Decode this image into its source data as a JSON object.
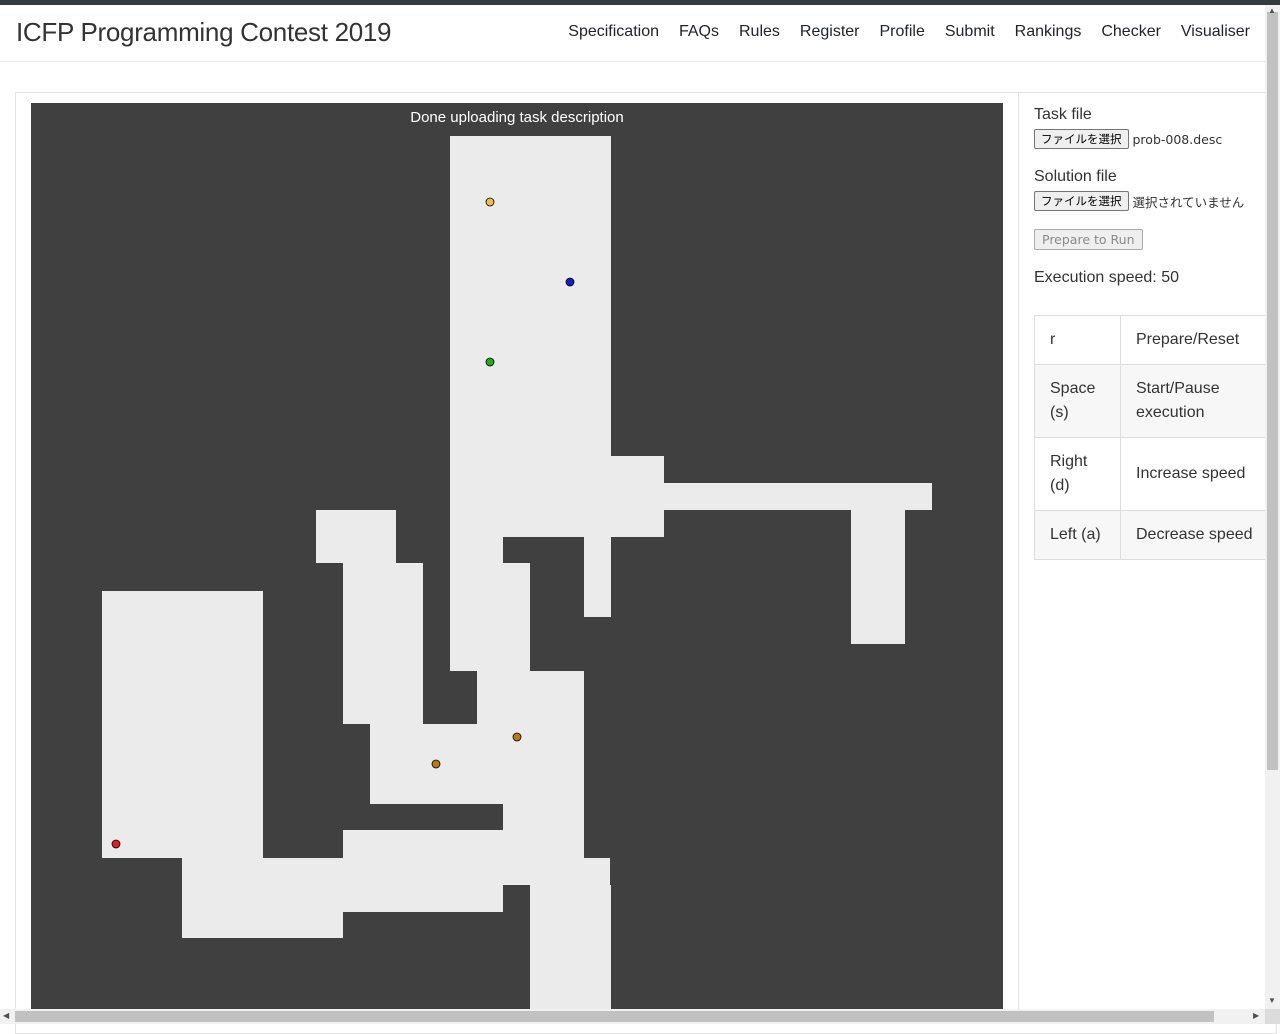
{
  "navbar": {
    "brand": "ICFP Programming Contest 2019",
    "links": [
      "Specification",
      "FAQs",
      "Rules",
      "Register",
      "Profile",
      "Submit",
      "Rankings",
      "Checker",
      "Visualiser"
    ]
  },
  "visualiser": {
    "status": "Done uploading task description",
    "colors": {
      "background": "#404040",
      "floor": "#ebebeb",
      "booster_yellow": "#f0c040",
      "booster_blue": "#1a1acc",
      "booster_green": "#22aa22",
      "booster_orange": "#b87a10",
      "worker_red": "#e02020"
    }
  },
  "panel": {
    "task_file_label": "Task file",
    "task_file_button": "ファイルを選択",
    "task_file_name": "prob-008.desc",
    "solution_file_label": "Solution file",
    "solution_file_button": "ファイルを選択",
    "solution_file_name": "選択されていません",
    "prepare_button": "Prepare to Run",
    "execution_speed": "Execution speed: 50"
  },
  "key_table": [
    {
      "key": "r",
      "action": "Prepare/Reset"
    },
    {
      "key": "Space (s)",
      "action": "Start/Pause execution"
    },
    {
      "key": "Right (d)",
      "action": "Increase speed"
    },
    {
      "key": "Left (a)",
      "action": "Decrease speed"
    }
  ],
  "icons": {
    "scroll_up": "scroll-up-arrow-icon",
    "scroll_down": "scroll-down-arrow-icon",
    "scroll_left": "scroll-left-arrow-icon",
    "scroll_right": "scroll-right-arrow-icon"
  }
}
